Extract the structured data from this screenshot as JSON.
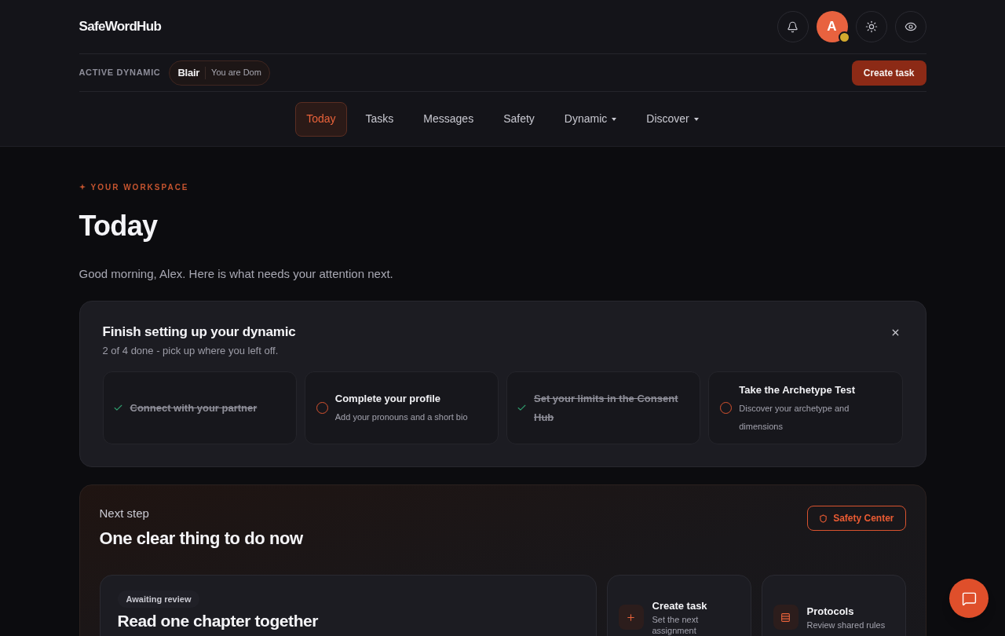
{
  "header": {
    "logo": "SafeWordHub",
    "avatar": {
      "initial": "A"
    }
  },
  "dynamic_bar": {
    "label": "ACTIVE DYNAMIC",
    "partner": "Blair",
    "role": "You are Dom",
    "create_button": "Create task"
  },
  "nav": [
    {
      "label": "Today",
      "selected": true,
      "dropdown": false
    },
    {
      "label": "Tasks",
      "selected": false,
      "dropdown": false
    },
    {
      "label": "Messages",
      "selected": false,
      "dropdown": false
    },
    {
      "label": "Safety",
      "selected": false,
      "dropdown": false
    },
    {
      "label": "Dynamic",
      "selected": false,
      "dropdown": true
    },
    {
      "label": "Discover",
      "selected": false,
      "dropdown": true
    }
  ],
  "workspace": {
    "eyebrow": "YOUR WORKSPACE",
    "title": "Today",
    "greeting": "Good morning, Alex. Here is what needs your attention next."
  },
  "setup": {
    "title": "Finish setting up your dynamic",
    "subtitle": "2 of 4 done - pick up where you left off.",
    "steps": [
      {
        "title": "Connect with your partner",
        "done": true
      },
      {
        "title": "Complete your profile",
        "description": "Add your pronouns and a short bio",
        "done": false
      },
      {
        "title": "Set your limits in the Consent Hub",
        "done": true
      },
      {
        "title": "Take the Archetype Test",
        "description": "Discover your archetype and dimensions",
        "done": false
      }
    ]
  },
  "next_step": {
    "eyebrow": "Next step",
    "title": "One clear thing to do now",
    "safety_button": "Safety Center",
    "task": {
      "badge": "Awaiting review",
      "title": "Read one chapter together"
    },
    "actions": [
      {
        "kind": "create",
        "title": "Create task",
        "description": "Set the next assignment"
      },
      {
        "kind": "protocols",
        "title": "Protocols",
        "description": "Review shared rules"
      }
    ]
  }
}
